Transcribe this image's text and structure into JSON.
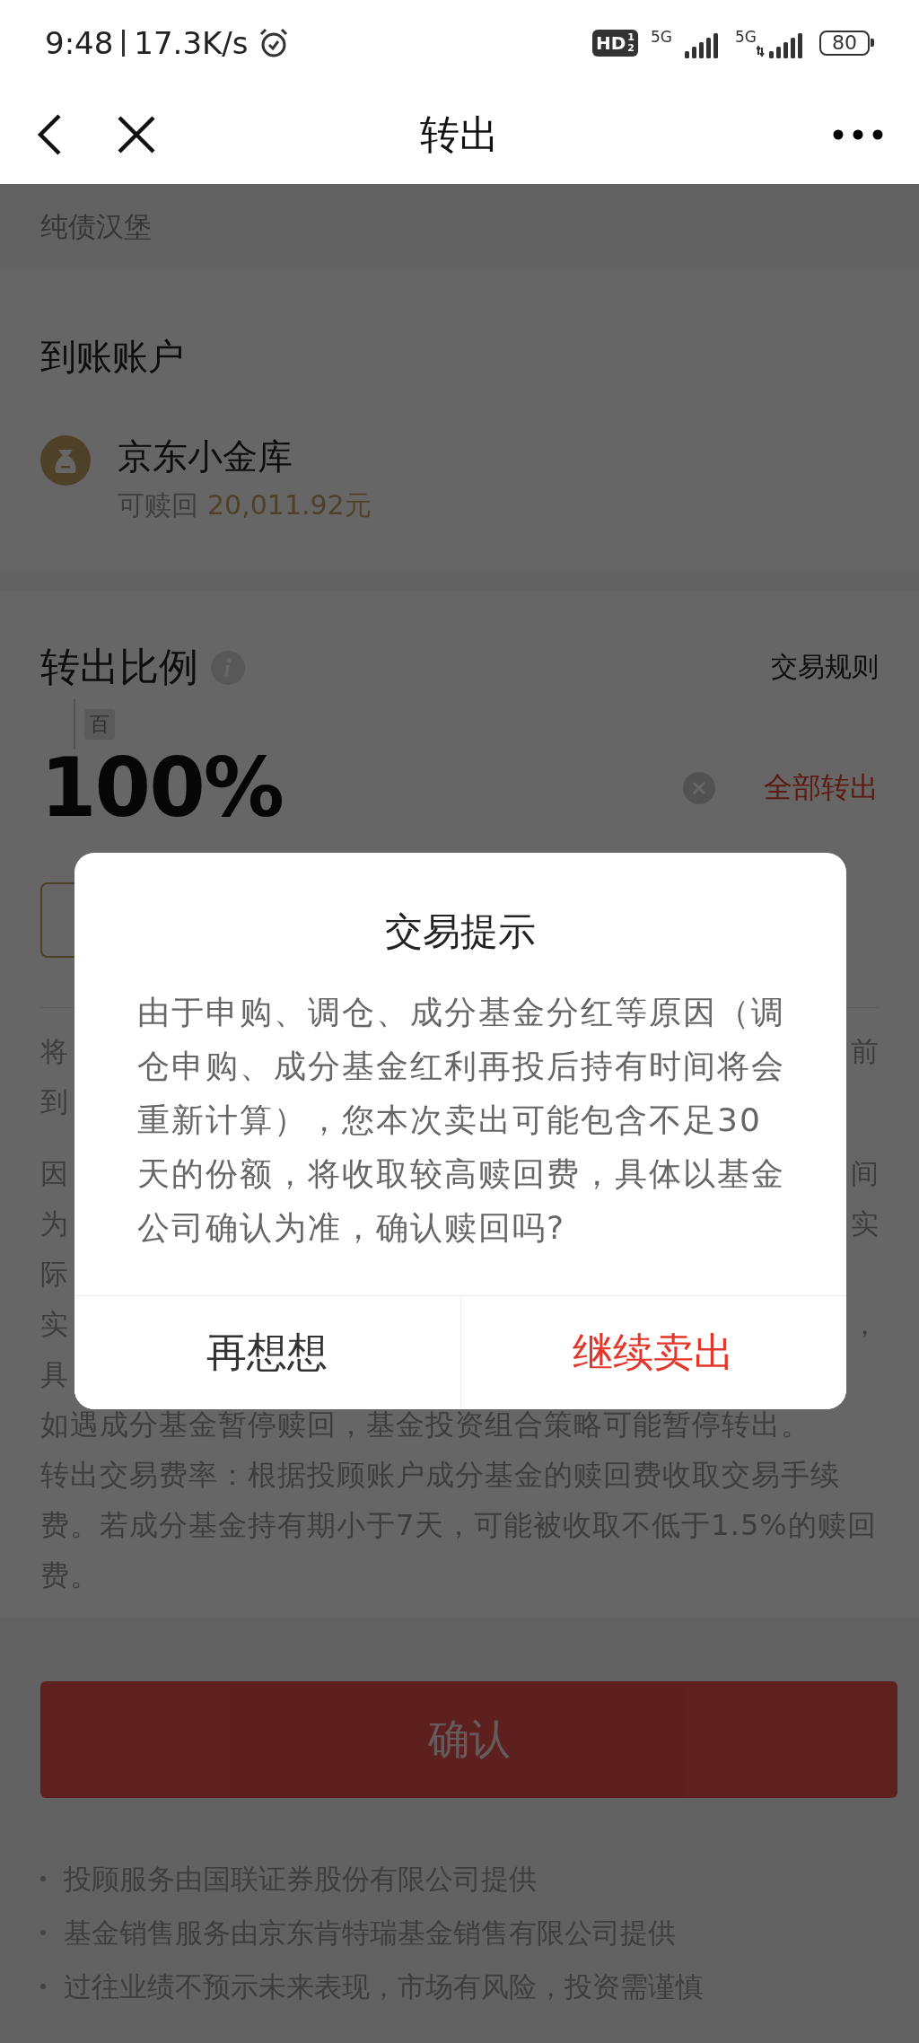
{
  "status_bar": {
    "time": "9:48",
    "speed": "17.3K/s",
    "hd_badge": {
      "label": "HD",
      "sims": [
        "1",
        "2"
      ]
    },
    "networks": [
      {
        "type": "5G",
        "activity": false
      },
      {
        "type": "5G",
        "activity": true
      }
    ],
    "battery": "80"
  },
  "nav": {
    "title": "转出"
  },
  "product": {
    "name": "纯债汉堡"
  },
  "account": {
    "heading": "到账账户",
    "name": "京东小金库",
    "redeemable_label": "可赎回",
    "redeemable_amount": "20,011.92元"
  },
  "ratio": {
    "heading": "转出比例",
    "rules_link": "交易规则",
    "unit_tag": "百",
    "value": "100%",
    "all_button": "全部转出"
  },
  "notes": [
    {
      "lines": [
        {
          "left": "将",
          "right": "前"
        },
        {
          "left": "到"
        }
      ]
    },
    {
      "lines": [
        {
          "left": "因",
          "right": "间"
        },
        {
          "left": "为",
          "right": "实"
        },
        {
          "left": "际"
        },
        {
          "left": "实",
          "right": "，"
        },
        {
          "left": "具"
        }
      ],
      "texts": [
        "如遇成分基金暂停赎回，基金投资组合策略可能暂停转出。",
        "转出交易费率：根据投顾账户成分基金的赎回费收取交易手续费。若成分基金持有期小于7天，可能被收取不低于1.5%的赎回费。"
      ]
    }
  ],
  "confirm_button": {
    "label": "确认",
    "disabled": true
  },
  "disclaimers": [
    "投顾服务由国联证券股份有限公司提供",
    "基金销售服务由京东肯特瑞基金销售有限公司提供",
    "过往业绩不预示未来表现，市场有风险，投资需谨慎"
  ],
  "dialog": {
    "title": "交易提示",
    "message": "由于申购、调仓、成分基金分红等原因（调仓申购、成分基金红利再投后持有时间将会重新计算），您本次卖出可能包含不足30天的份额，将收取较高赎回费，具体以基金公司确认为准，确认赎回吗?",
    "buttons": [
      {
        "label": "再想想",
        "kind": "cancel"
      },
      {
        "label": "继续卖出",
        "kind": "primary"
      }
    ]
  }
}
